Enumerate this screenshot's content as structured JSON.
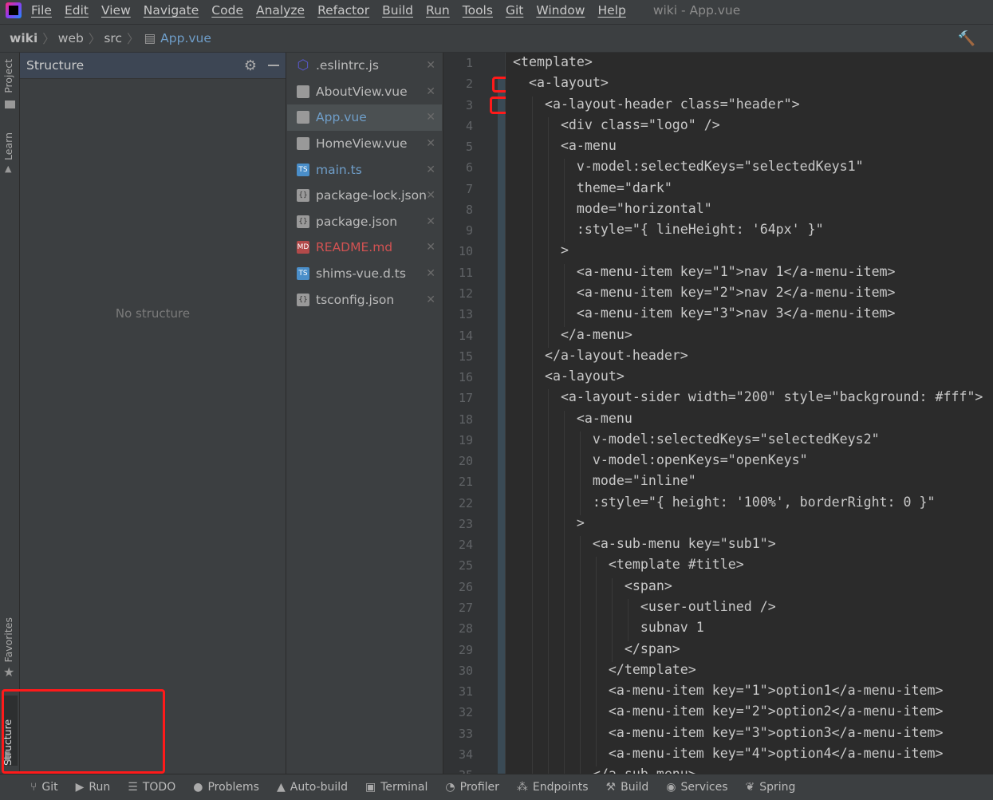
{
  "menubar": {
    "items": [
      "File",
      "Edit",
      "View",
      "Navigate",
      "Code",
      "Analyze",
      "Refactor",
      "Build",
      "Run",
      "Tools",
      "Git",
      "Window",
      "Help"
    ],
    "title": "wiki - App.vue"
  },
  "breadcrumb": [
    "wiki",
    "web",
    "src",
    "App.vue"
  ],
  "left_strip": {
    "project": "Project",
    "learn": "Learn",
    "favorites": "Favorites",
    "structure": "Structure"
  },
  "structure_panel": {
    "title": "Structure",
    "empty_text": "No structure"
  },
  "files": [
    {
      "name": ".eslintrc.js",
      "icon": "eslint-icon",
      "color": "#bbbbbb"
    },
    {
      "name": "AboutView.vue",
      "icon": "file-icon",
      "color": "#bbbbbb"
    },
    {
      "name": "App.vue",
      "icon": "file-icon",
      "color": "#6f9ec9",
      "selected": true
    },
    {
      "name": "HomeView.vue",
      "icon": "file-icon",
      "color": "#bbbbbb"
    },
    {
      "name": "main.ts",
      "icon": "typescript-icon",
      "color": "#6f9ec9"
    },
    {
      "name": "package-lock.json",
      "icon": "json-icon",
      "color": "#bbbbbb"
    },
    {
      "name": "package.json",
      "icon": "json-icon",
      "color": "#bbbbbb"
    },
    {
      "name": "README.md",
      "icon": "markdown-icon",
      "color": "#d25252"
    },
    {
      "name": "shims-vue.d.ts",
      "icon": "typescript-icon",
      "color": "#bbbbbb"
    },
    {
      "name": "tsconfig.json",
      "icon": "json-icon",
      "color": "#bbbbbb"
    }
  ],
  "code_lines": [
    "<template>",
    "  <a-layout>",
    "    <a-layout-header class=\"header\">",
    "      <div class=\"logo\" />",
    "      <a-menu",
    "        v-model:selectedKeys=\"selectedKeys1\"",
    "        theme=\"dark\"",
    "        mode=\"horizontal\"",
    "        :style=\"{ lineHeight: '64px' }\"",
    "      >",
    "        <a-menu-item key=\"1\">nav 1</a-menu-item>",
    "        <a-menu-item key=\"2\">nav 2</a-menu-item>",
    "        <a-menu-item key=\"3\">nav 3</a-menu-item>",
    "      </a-menu>",
    "    </a-layout-header>",
    "    <a-layout>",
    "      <a-layout-sider width=\"200\" style=\"background: #fff\">",
    "        <a-menu",
    "          v-model:selectedKeys=\"selectedKeys2\"",
    "          v-model:openKeys=\"openKeys\"",
    "          mode=\"inline\"",
    "          :style=\"{ height: '100%', borderRight: 0 }\"",
    "        >",
    "          <a-sub-menu key=\"sub1\">",
    "            <template #title>",
    "              <span>",
    "                <user-outlined />",
    "                subnav 1",
    "              </span>",
    "            </template>",
    "            <a-menu-item key=\"1\">option1</a-menu-item>",
    "            <a-menu-item key=\"2\">option2</a-menu-item>",
    "            <a-menu-item key=\"3\">option3</a-menu-item>",
    "            <a-menu-item key=\"4\">option4</a-menu-item>",
    "          </a-sub-menu>"
  ],
  "bottom_tools": [
    {
      "label": "Git",
      "icon": "git-branch-icon"
    },
    {
      "label": "Run",
      "icon": "run-icon"
    },
    {
      "label": "TODO",
      "icon": "list-icon"
    },
    {
      "label": "Problems",
      "icon": "problems-icon"
    },
    {
      "label": "Auto-build",
      "icon": "warning-icon"
    },
    {
      "label": "Terminal",
      "icon": "terminal-icon"
    },
    {
      "label": "Profiler",
      "icon": "profiler-icon"
    },
    {
      "label": "Endpoints",
      "icon": "endpoints-icon"
    },
    {
      "label": "Build",
      "icon": "hammer-icon"
    },
    {
      "label": "Services",
      "icon": "services-icon"
    },
    {
      "label": "Spring",
      "icon": "spring-icon"
    }
  ],
  "colors": {
    "annotation": "#ff1a1a",
    "accent": "#6f9ec9"
  }
}
